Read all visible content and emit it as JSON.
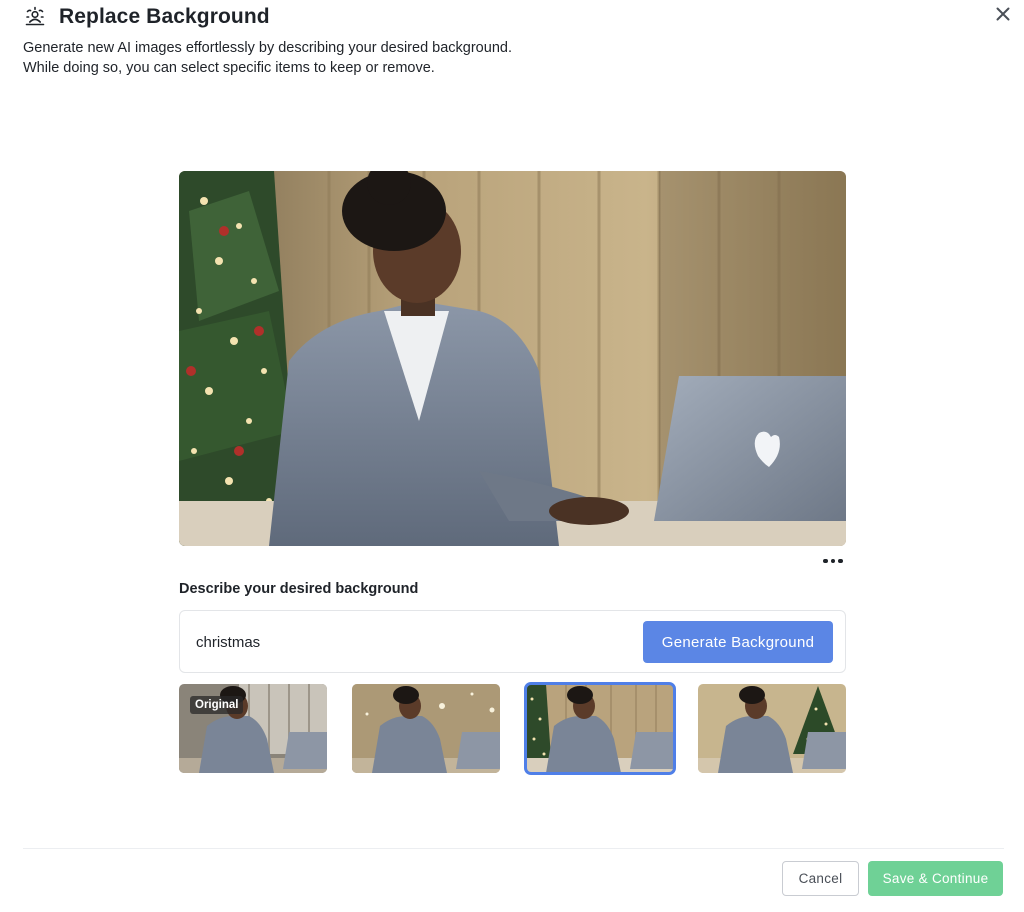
{
  "dialog": {
    "title": "Replace Background",
    "title_icon": "replace-background-icon",
    "close_icon": "close-icon",
    "subtitle_line1": "Generate new AI images effortlessly by describing your desired background.",
    "subtitle_line2": "While doing so, you can select specific items to keep or remove."
  },
  "preview": {
    "image": "woman-laptop-christmas-background",
    "more_icon": "more-horizontal-icon"
  },
  "prompt": {
    "label": "Describe your desired background",
    "value": "christmas",
    "generate_label": "Generate Background"
  },
  "variations": [
    {
      "badge": "Original",
      "scene": "office-window",
      "selected": false
    },
    {
      "badge": "",
      "scene": "sparkle-lights",
      "selected": false
    },
    {
      "badge": "",
      "scene": "christmas-curtains",
      "selected": true
    },
    {
      "badge": "",
      "scene": "christmas-tree",
      "selected": false
    }
  ],
  "footer": {
    "cancel_label": "Cancel",
    "save_label": "Save & Continue"
  },
  "colors": {
    "primary": "#5b86e5",
    "selected_outline": "#4f7fe8",
    "save": "#6fd196",
    "text": "#1f2329"
  }
}
